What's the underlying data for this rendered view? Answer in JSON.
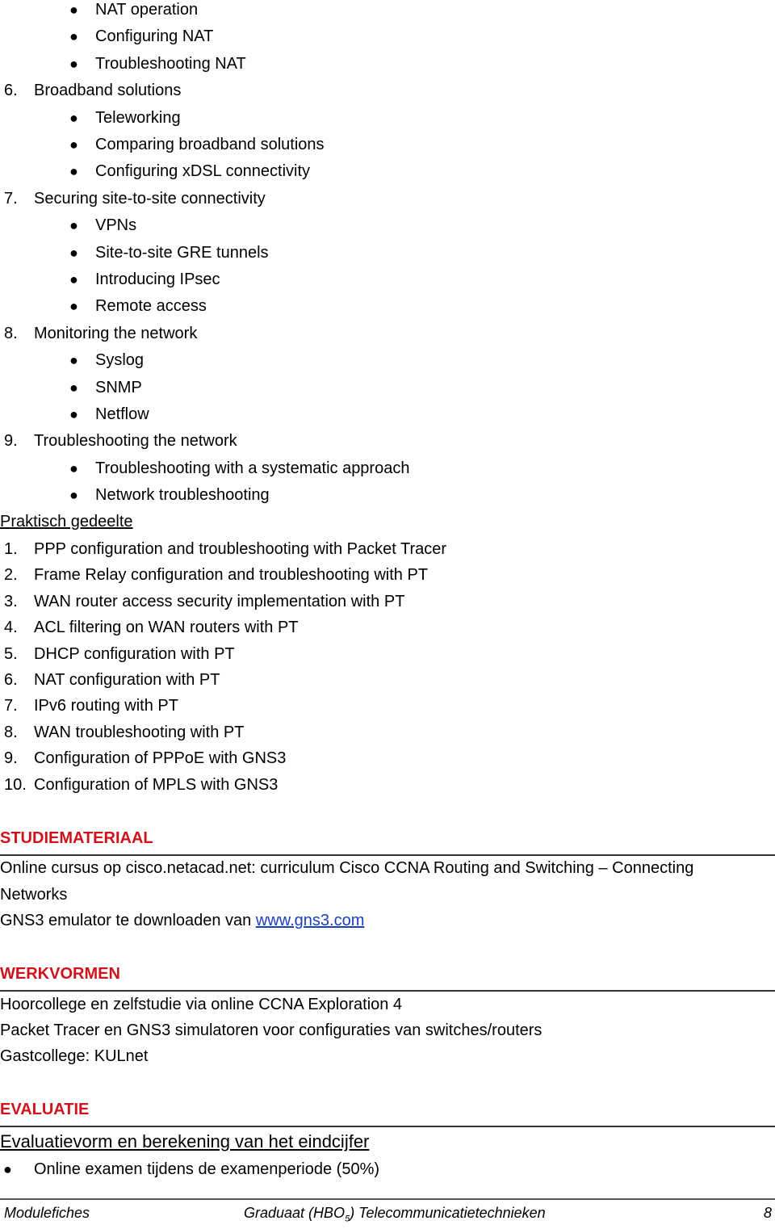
{
  "theory_tail": [
    {
      "type": "bullet",
      "text": "NAT operation"
    },
    {
      "type": "bullet",
      "text": "Configuring NAT"
    },
    {
      "type": "bullet",
      "text": "Troubleshooting NAT"
    },
    {
      "type": "num",
      "n": "6.",
      "text": "Broadband solutions"
    },
    {
      "type": "bullet",
      "text": "Teleworking"
    },
    {
      "type": "bullet",
      "text": "Comparing broadband solutions"
    },
    {
      "type": "bullet",
      "text": "Configuring xDSL connectivity"
    },
    {
      "type": "num",
      "n": "7.",
      "text": "Securing site-to-site connectivity"
    },
    {
      "type": "bullet",
      "text": "VPNs"
    },
    {
      "type": "bullet",
      "text": "Site-to-site GRE tunnels"
    },
    {
      "type": "bullet",
      "text": "Introducing IPsec"
    },
    {
      "type": "bullet",
      "text": "Remote access"
    },
    {
      "type": "num",
      "n": "8.",
      "text": "Monitoring the network"
    },
    {
      "type": "bullet",
      "text": "Syslog"
    },
    {
      "type": "bullet",
      "text": "SNMP"
    },
    {
      "type": "bullet",
      "text": "Netflow"
    },
    {
      "type": "num",
      "n": "9.",
      "text": "Troubleshooting the network"
    },
    {
      "type": "bullet",
      "text": "Troubleshooting with a systematic approach"
    },
    {
      "type": "bullet",
      "text": "Network troubleshooting"
    }
  ],
  "practical": {
    "heading": "Praktisch gedeelte",
    "items": [
      {
        "n": "1.",
        "text": "PPP configuration and troubleshooting with Packet Tracer"
      },
      {
        "n": "2.",
        "text": "Frame Relay configuration and troubleshooting with PT"
      },
      {
        "n": "3.",
        "text": "WAN router access security implementation with PT"
      },
      {
        "n": "4.",
        "text": "ACL filtering on WAN routers with PT"
      },
      {
        "n": "5.",
        "text": "DHCP configuration with PT"
      },
      {
        "n": "6.",
        "text": "NAT configuration with PT"
      },
      {
        "n": "7.",
        "text": "IPv6 routing with PT"
      },
      {
        "n": "8.",
        "text": "WAN troubleshooting with PT"
      },
      {
        "n": "9.",
        "text": "Configuration of PPPoE with GNS3"
      },
      {
        "n": "10.",
        "text": "Configuration of MPLS with GNS3"
      }
    ]
  },
  "studiemateriaal": {
    "heading": "STUDIEMATERIAAL",
    "line1": "Online cursus op cisco.netacad.net: curriculum Cisco CCNA Routing and Switching – Connecting",
    "line2": "Networks",
    "line3_prefix": "GNS3 emulator te downloaden van ",
    "line3_link": "www.gns3.com"
  },
  "werkvormen": {
    "heading": "WERKVORMEN",
    "lines": [
      "Hoorcollege en zelfstudie via online CCNA Exploration 4",
      "Packet Tracer en GNS3 simulatoren voor configuraties van switches/routers",
      "Gastcollege: KULnet"
    ]
  },
  "evaluatie": {
    "heading": "EVALUATIE",
    "subheading": "Evaluatievorm en berekening van het eindcijfer",
    "bullet": "Online examen tijdens de examenperiode (50%)"
  },
  "footer": {
    "left": "Modulefiches",
    "center_pre": "Graduaat (HBO",
    "center_sub": "5",
    "center_post": ") Telecommunicatietechnieken",
    "page": "8"
  }
}
